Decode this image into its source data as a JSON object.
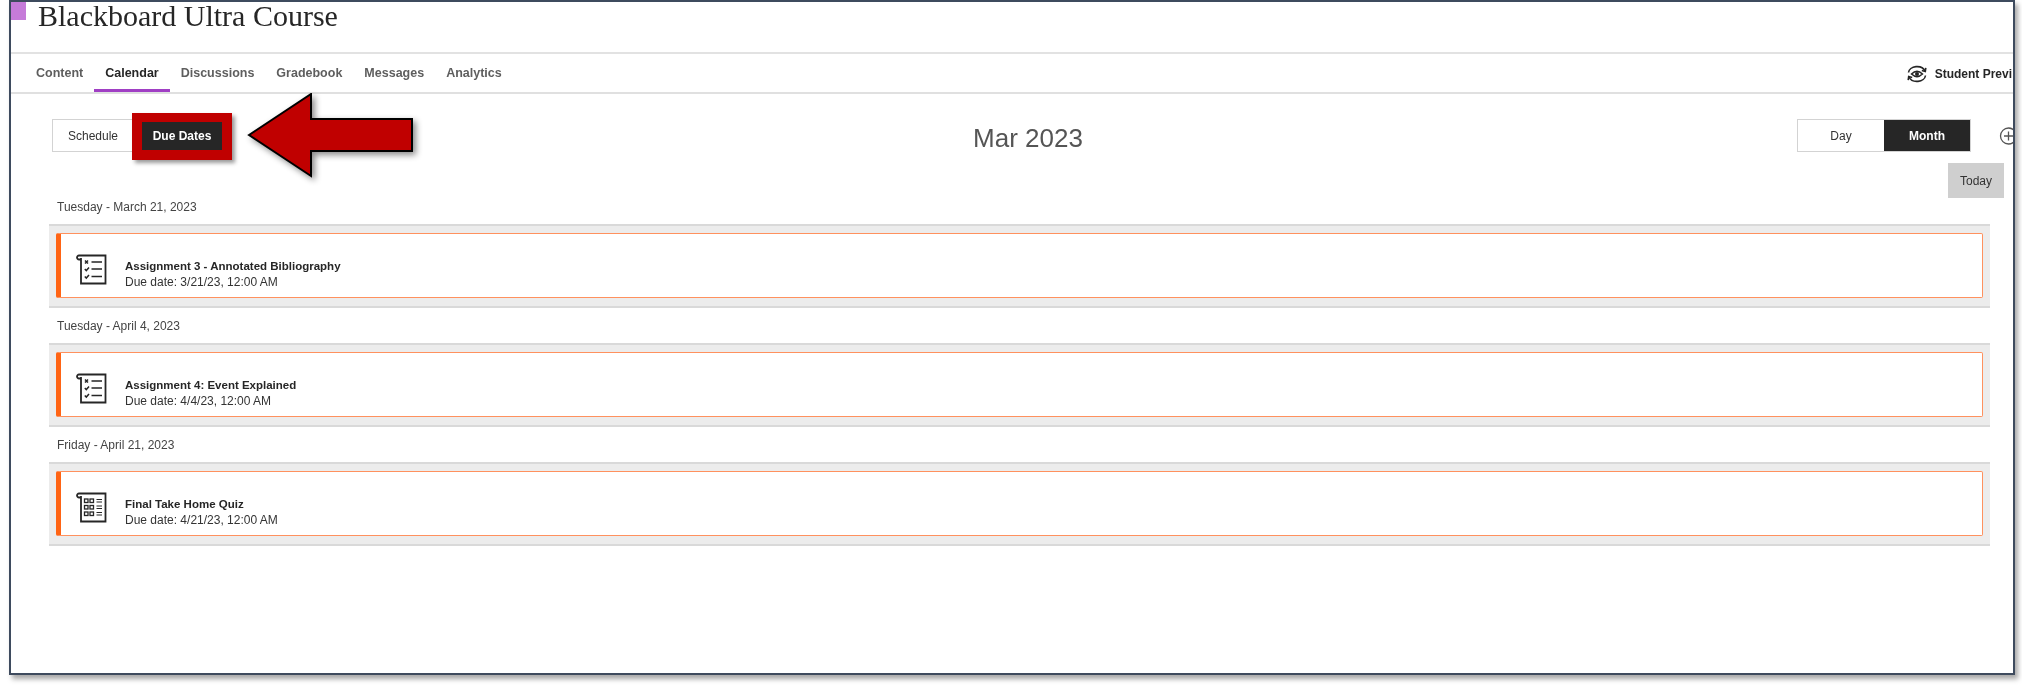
{
  "header": {
    "title": "Blackboard Ultra Course"
  },
  "tabs": [
    {
      "label": "Content",
      "selected": false
    },
    {
      "label": "Calendar",
      "selected": true
    },
    {
      "label": "Discussions",
      "selected": false
    },
    {
      "label": "Gradebook",
      "selected": false
    },
    {
      "label": "Messages",
      "selected": false
    },
    {
      "label": "Analytics",
      "selected": false
    }
  ],
  "student_preview": {
    "label": "Student Previ"
  },
  "view_toggle": [
    {
      "label": "Schedule",
      "selected": false,
      "callout_frame": false,
      "callout_arrow": false
    },
    {
      "label": "Due Dates",
      "selected": true,
      "callout_frame": true,
      "callout_arrow": true
    }
  ],
  "month_title": "Mar 2023",
  "range_toggle": [
    {
      "label": "Day",
      "selected": false
    },
    {
      "label": "Month",
      "selected": true
    }
  ],
  "today_button": {
    "label": "Today"
  },
  "due_groups": [
    {
      "date": "Tuesday - March 21, 2023",
      "items": [
        {
          "kind": "assignment",
          "title": "Assignment 3 - Annotated Bibliography",
          "due": "Due date: 3/21/23, 12:00 AM"
        }
      ]
    },
    {
      "date": "Tuesday - April 4, 2023",
      "items": [
        {
          "kind": "assignment",
          "title": "Assignment 4: Event Explained",
          "due": "Due date: 4/4/23, 12:00 AM"
        }
      ]
    },
    {
      "date": "Friday - April 21, 2023",
      "items": [
        {
          "kind": "test",
          "title": "Final Take Home Quiz",
          "due": "Due date: 4/21/23, 12:00 AM"
        }
      ]
    }
  ]
}
